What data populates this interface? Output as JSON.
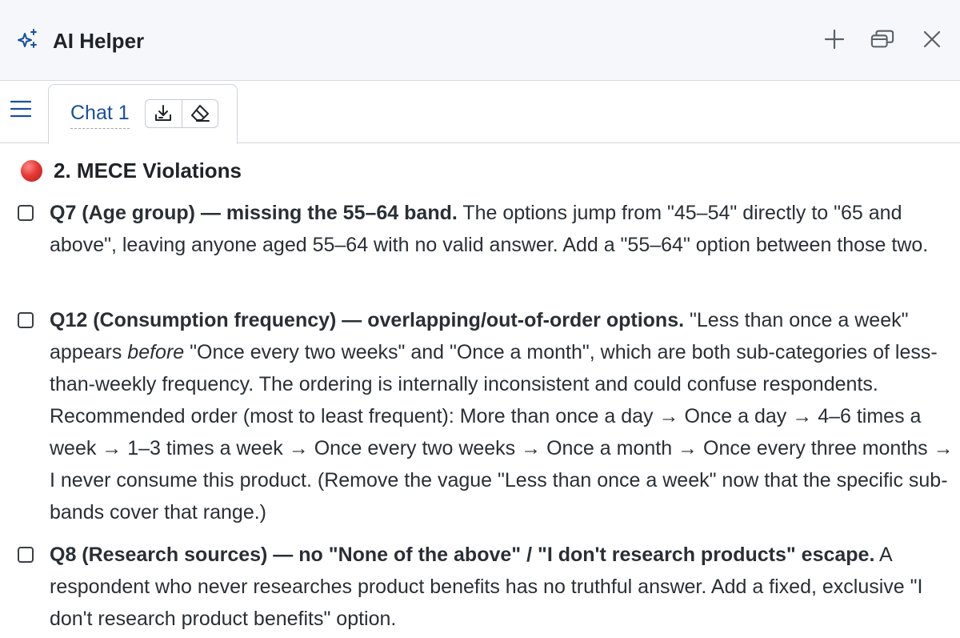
{
  "header": {
    "title": "AI Helper",
    "icons": [
      "sparkle-icon",
      "plus-icon",
      "restore-window-icon",
      "close-icon"
    ]
  },
  "tabs": [
    {
      "label": "Chat 1",
      "actions": [
        "download-icon",
        "eraser-icon"
      ]
    }
  ],
  "section": {
    "status_color": "#e53935",
    "title": "2. MECE Violations"
  },
  "items": [
    {
      "bold": "Q7 (Age group) — missing the 55–64 band.",
      "text": " The options jump from \"45–54\" directly to \"65 and above\", leaving anyone aged 55–64 with no valid answer. Add a \"55–64\" option between those two."
    },
    {
      "bold": "Q12 (Consumption frequency) — overlapping/out-of-order options.",
      "text_a": " \"Less than once a week\" appears ",
      "italic": "before",
      "text_b": " \"Once every two weeks\" and \"Once a month\", which are both sub-categories of less-than-weekly frequency. The ordering is internally inconsistent and could confuse respondents. Recommended order (most to least frequent): More than once a day → Once a day → 4–6 times a week → 1–3 times a week → Once every two weeks → Once a month → Once every three months → I never consume this product. (Remove the vague \"Less than once a week\" now that the specific sub-bands cover that range.)"
    },
    {
      "bold": "Q8 (Research sources) — no \"None of the above\" / \"I don't research products\" escape.",
      "text": " A respondent who never researches product benefits has no truthful answer. Add a fixed, exclusive \"I don't research product benefits\" option."
    }
  ]
}
